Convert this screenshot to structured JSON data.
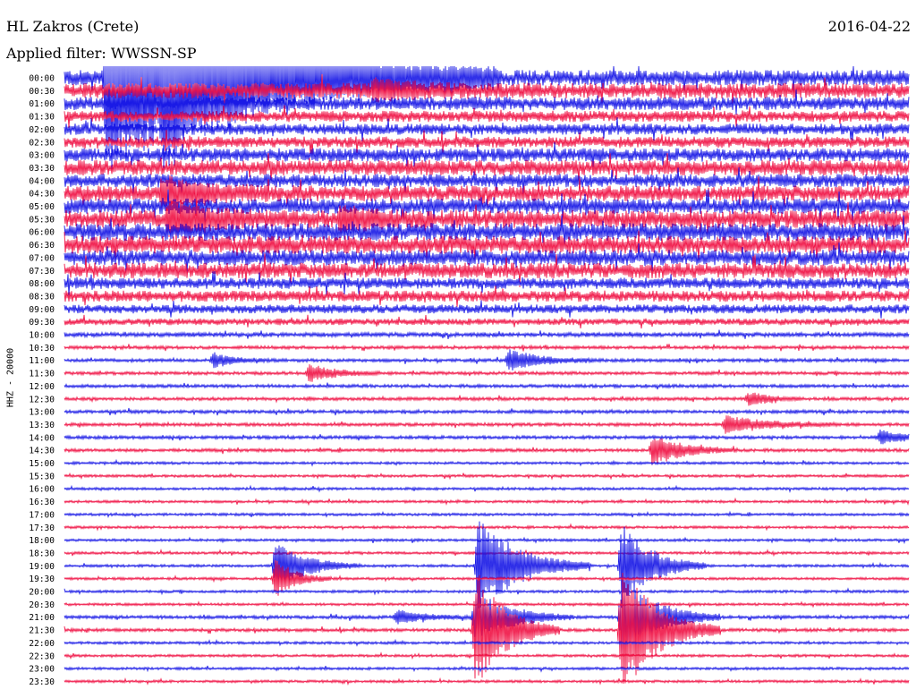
{
  "header": {
    "station": "HL Zakros (Crete)",
    "date": "2016-04-22",
    "filter": "Applied filter: WWSSN-SP",
    "channel": "HHZ - 20000"
  },
  "colors": {
    "blue": "#1a1ae6",
    "red": "#f01446"
  },
  "chart_data": {
    "type": "line",
    "title": "HL Zakros (Crete)",
    "date": "2016-04-22",
    "filter": "WWSSN-SP",
    "ylabel": "HHZ - 20000",
    "rows": [
      "00:00",
      "00:30",
      "01:00",
      "01:30",
      "02:00",
      "02:30",
      "03:00",
      "03:30",
      "04:00",
      "04:30",
      "05:00",
      "05:30",
      "06:00",
      "06:30",
      "07:00",
      "07:30",
      "08:00",
      "08:30",
      "09:00",
      "09:30",
      "10:00",
      "10:30",
      "11:00",
      "11:30",
      "12:00",
      "12:30",
      "13:00",
      "13:30",
      "14:00",
      "14:30",
      "15:00",
      "15:30",
      "16:00",
      "16:30",
      "17:00",
      "17:30",
      "18:00",
      "18:30",
      "19:00",
      "19:30",
      "20:00",
      "20:30",
      "21:00",
      "21:30",
      "22:00",
      "22:30",
      "23:00",
      "23:30"
    ],
    "row_colors": [
      "blue",
      "red"
    ],
    "row_minutes": 30,
    "noise_levels": [
      7,
      7,
      6,
      5,
      5,
      5,
      6,
      7,
      6,
      7,
      7,
      8,
      8,
      8,
      7,
      7,
      5,
      5,
      4,
      3,
      2,
      1.5,
      1.5,
      1.5,
      1.5,
      1.5,
      1.5,
      1.5,
      1.5,
      1.5,
      1.2,
      1.2,
      1.2,
      1.2,
      1.2,
      1.2,
      1.2,
      1.2,
      1.2,
      1.2,
      1.2,
      1.2,
      1.5,
      1.5,
      1.2,
      1.2,
      1.2,
      1.2
    ],
    "events": [
      {
        "row": 0,
        "minute": 1.5,
        "amplitude": 110,
        "duration": 14
      },
      {
        "row": 0,
        "minute": 3.5,
        "amplitude": 40,
        "duration": 4
      },
      {
        "row": 1,
        "minute": 11,
        "amplitude": 10,
        "duration": 3
      },
      {
        "row": 9,
        "minute": 3.5,
        "amplitude": 15,
        "duration": 4
      },
      {
        "row": 11,
        "minute": 3.7,
        "amplitude": 18,
        "duration": 4
      },
      {
        "row": 11,
        "minute": 9.8,
        "amplitude": 12,
        "duration": 3
      },
      {
        "row": 22,
        "minute": 5.3,
        "amplitude": 8,
        "duration": 2
      },
      {
        "row": 22,
        "minute": 15.8,
        "amplitude": 12,
        "duration": 3
      },
      {
        "row": 23,
        "minute": 8.7,
        "amplitude": 10,
        "duration": 2.5
      },
      {
        "row": 25,
        "minute": 24.3,
        "amplitude": 8,
        "duration": 2
      },
      {
        "row": 27,
        "minute": 23.5,
        "amplitude": 10,
        "duration": 4
      },
      {
        "row": 28,
        "minute": 29,
        "amplitude": 7,
        "duration": 3
      },
      {
        "row": 29,
        "minute": 20.9,
        "amplitude": 18,
        "duration": 3
      },
      {
        "row": 38,
        "minute": 7.5,
        "amplitude": 28,
        "duration": 3
      },
      {
        "row": 38,
        "minute": 14.7,
        "amplitude": 55,
        "duration": 4
      },
      {
        "row": 38,
        "minute": 19.8,
        "amplitude": 48,
        "duration": 3
      },
      {
        "row": 39,
        "minute": 7.5,
        "amplitude": 22,
        "duration": 2
      },
      {
        "row": 42,
        "minute": 11.8,
        "amplitude": 7,
        "duration": 3
      },
      {
        "row": 42,
        "minute": 14.6,
        "amplitude": 30,
        "duration": 3.5
      },
      {
        "row": 42,
        "minute": 19.8,
        "amplitude": 45,
        "duration": 3.5
      },
      {
        "row": 43,
        "minute": 14.6,
        "amplitude": 70,
        "duration": 3
      },
      {
        "row": 43,
        "minute": 19.8,
        "amplitude": 75,
        "duration": 3.5
      }
    ]
  }
}
